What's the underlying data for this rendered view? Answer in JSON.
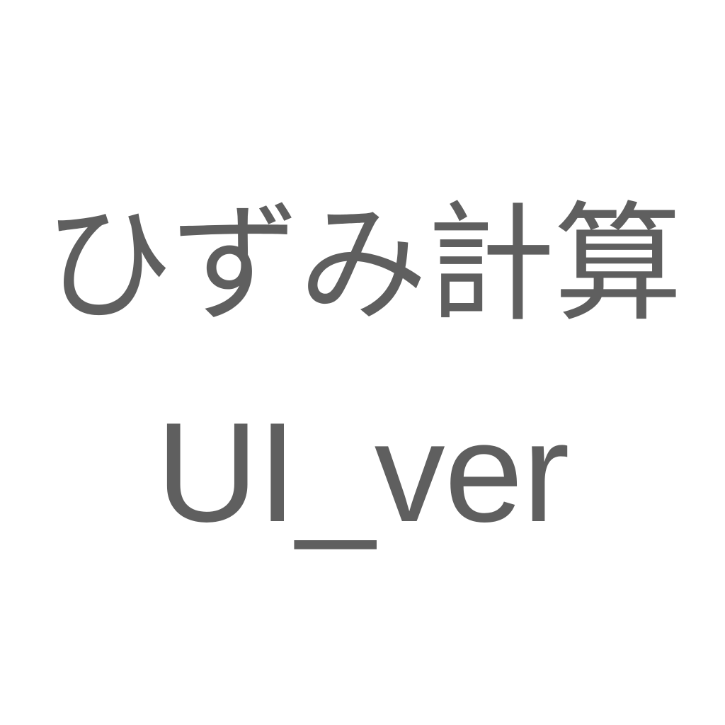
{
  "title_line_1": "ひずみ計算",
  "title_line_2": "UI_ver",
  "colors": {
    "background": "#ffffff",
    "text": "#5f5f5f"
  }
}
